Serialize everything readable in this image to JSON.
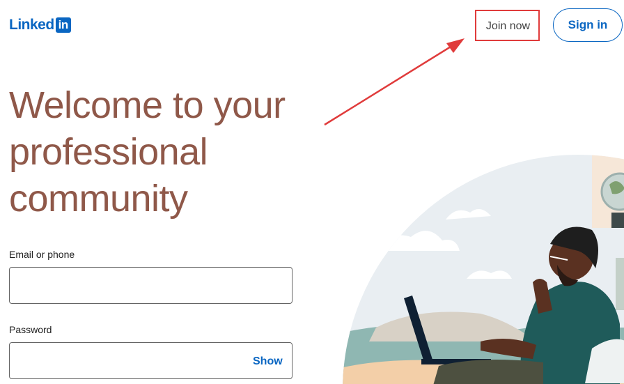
{
  "header": {
    "logo_text": "Linked",
    "logo_badge": "in",
    "join_label": "Join now",
    "signin_label": "Sign in"
  },
  "main": {
    "headline_line1": "Welcome to your",
    "headline_line2": "professional",
    "headline_line3": "community",
    "email_label": "Email or phone",
    "email_value": "",
    "password_label": "Password",
    "password_value": "",
    "show_label": "Show"
  },
  "annotation": {
    "highlight_color": "#e03b3b",
    "icon": "red-arrow-icon"
  },
  "colors": {
    "brand": "#0a66c2",
    "headline": "#8f5849"
  },
  "illustration": {
    "icon": "person-with-laptop-illustration"
  }
}
